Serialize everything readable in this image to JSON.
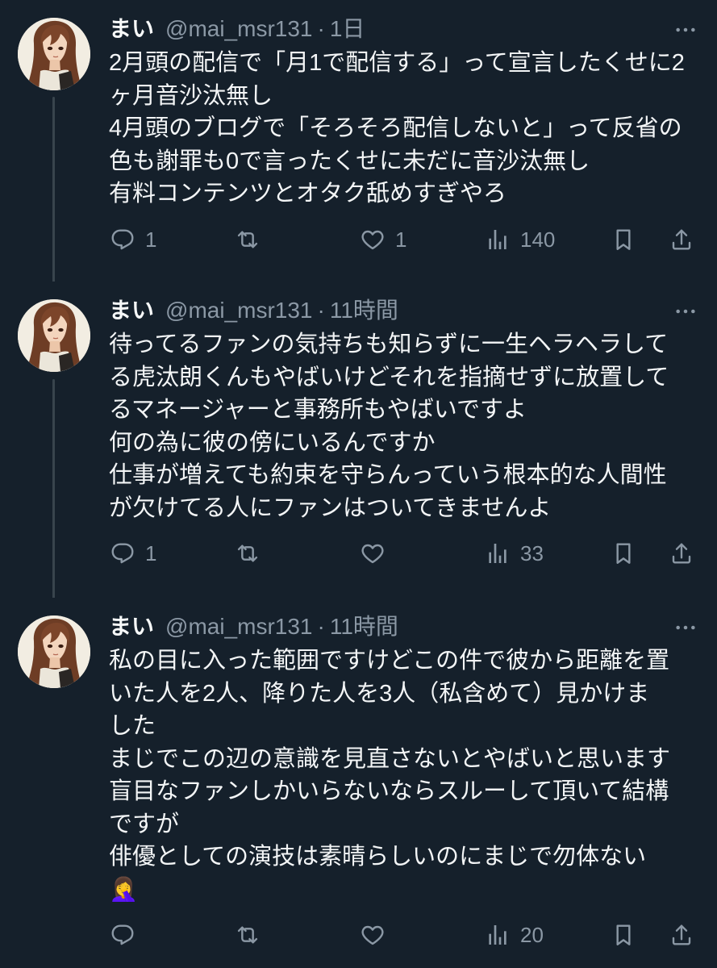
{
  "theme": {
    "background": "#15202b",
    "text": "#e7e9ea",
    "muted": "#8b98a5",
    "thread_line": "#38444d"
  },
  "icons": {
    "avatar": "avatar",
    "more": "more-icon",
    "reply": "reply-icon",
    "retweet": "retweet-icon",
    "like": "heart-icon",
    "views": "views-icon",
    "bookmark": "bookmark-icon",
    "share": "share-icon"
  },
  "tweets": [
    {
      "author_name": "まい",
      "author_handle": "@mai_msr131",
      "separator": "·",
      "time": "1日",
      "text_lines": [
        "2月頭の配信で「月1で配信する」って宣言したくせに2",
        "ヶ月音沙汰無し",
        "4月頭のブログで「そろそろ配信しないと」って反省の",
        "色も謝罪も0で言ったくせに未だに音沙汰無し",
        "有料コンテンツとオタク舐めすぎやろ"
      ],
      "actions": {
        "reply_count": "1",
        "like_count": "1",
        "views_count": "140"
      }
    },
    {
      "author_name": "まい",
      "author_handle": "@mai_msr131",
      "separator": "·",
      "time": "11時間",
      "text_lines": [
        "待ってるファンの気持ちも知らずに一生ヘラヘラして",
        "る虎汰朗くんもやばいけどそれを指摘せずに放置して",
        "るマネージャーと事務所もやばいですよ",
        "何の為に彼の傍にいるんですか",
        "仕事が増えても約束を守らんっていう根本的な人間性",
        "が欠けてる人にファンはついてきませんよ"
      ],
      "actions": {
        "reply_count": "1",
        "views_count": "33"
      }
    },
    {
      "author_name": "まい",
      "author_handle": "@mai_msr131",
      "separator": "·",
      "time": "11時間",
      "text_lines": [
        "私の目に入った範囲ですけどこの件で彼から距離を置",
        "いた人を2人、降りた人を3人（私含めて）見かけま",
        "した",
        "まじでこの辺の意識を見直さないとやばいと思います",
        "盲目なファンしかいらないならスルーして頂いて結構",
        "ですが",
        "俳優としての演技は素晴らしいのにまじで勿体ない",
        "🤦‍♀️"
      ],
      "actions": {
        "views_count": "20"
      }
    }
  ]
}
